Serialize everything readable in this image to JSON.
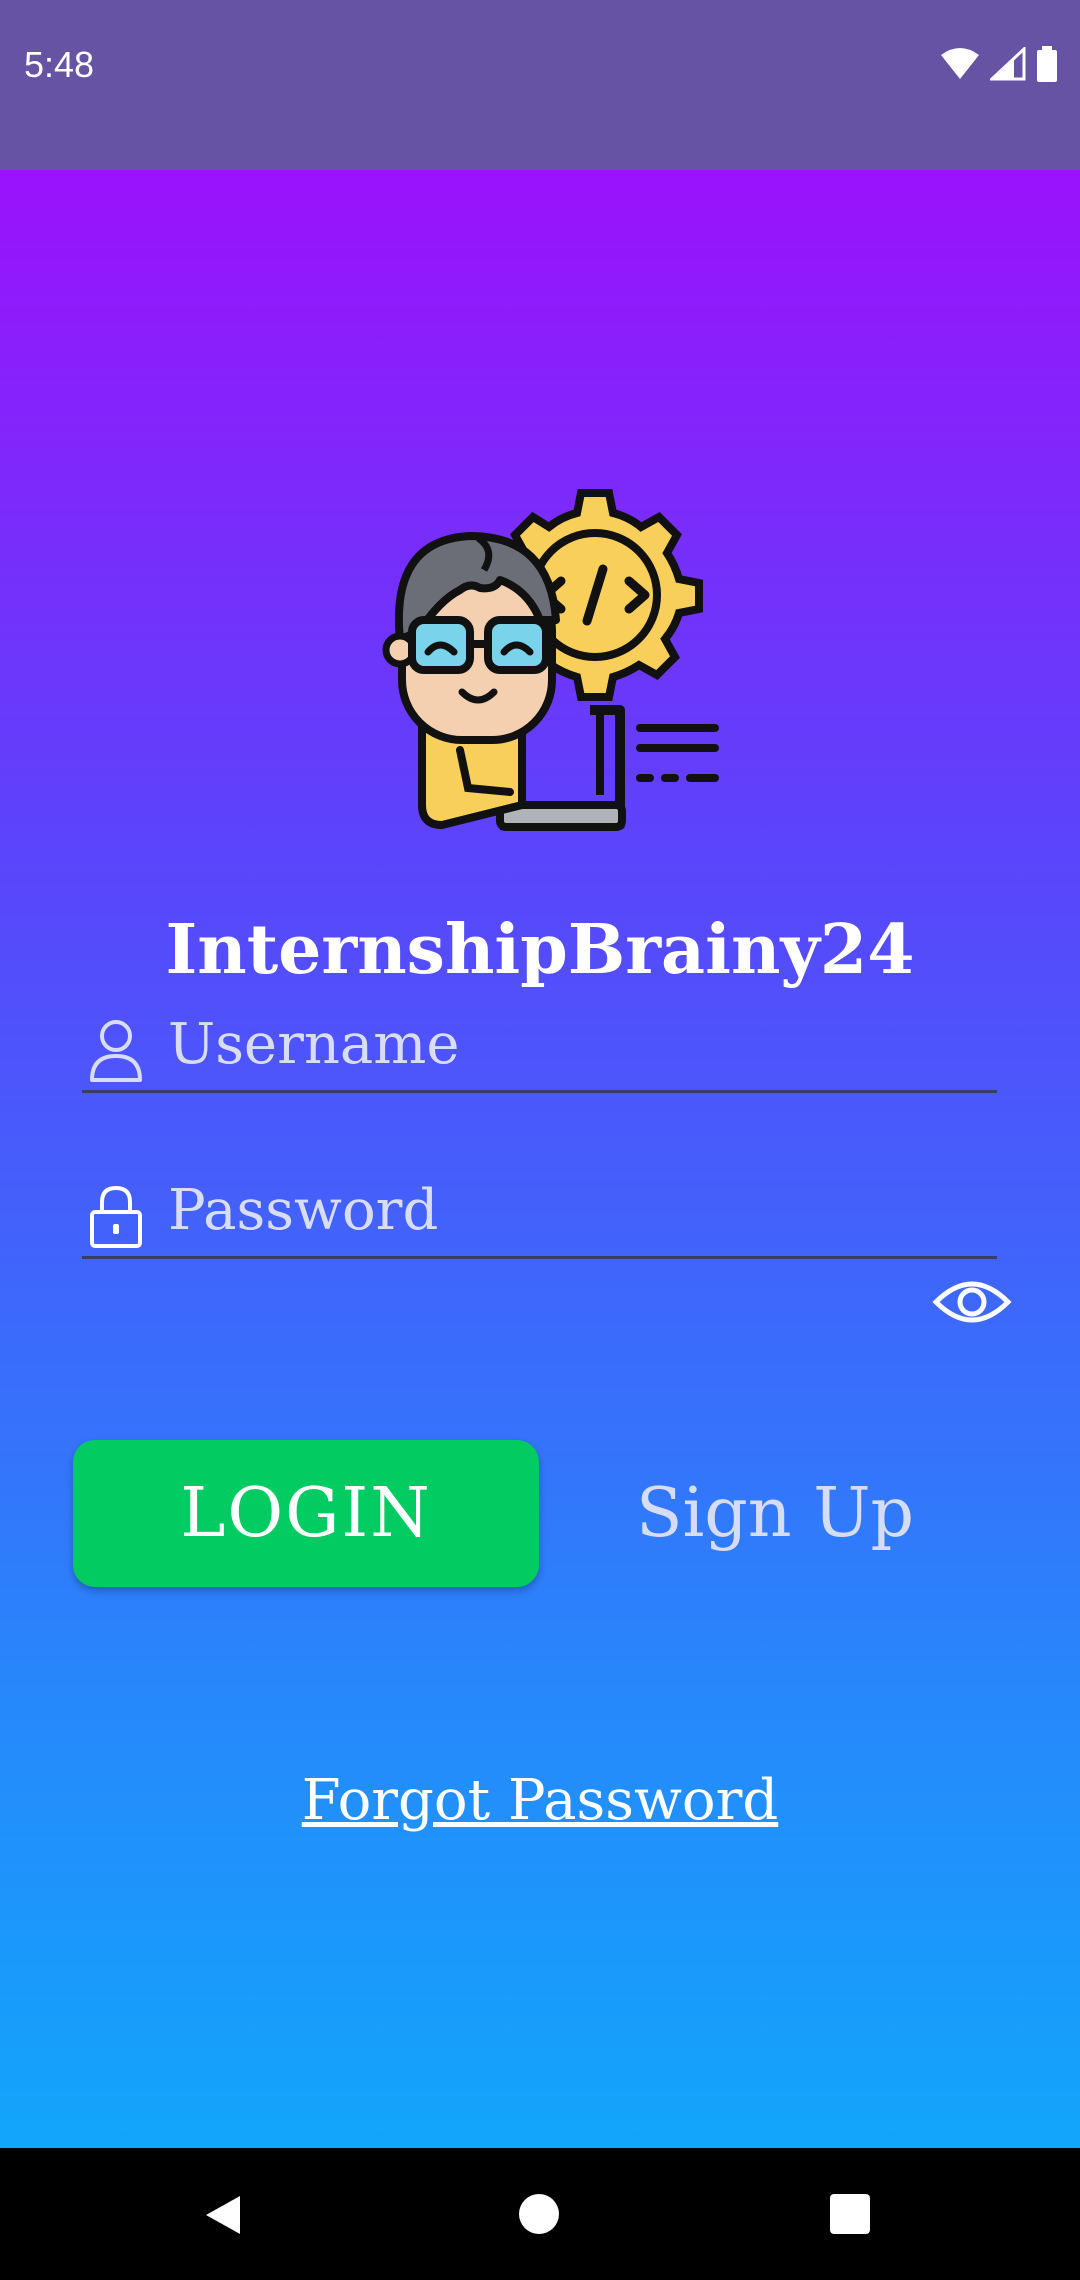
{
  "status_bar": {
    "time": "5:48",
    "icons": [
      "wifi-icon",
      "signal-icon",
      "battery-icon"
    ]
  },
  "app": {
    "title": "InternshipBrainy24",
    "logo": "developer-gear-laptop-illustration"
  },
  "form": {
    "username_placeholder": "Username",
    "password_placeholder": "Password",
    "username_icon": "user-icon",
    "password_icon": "lock-icon",
    "password_toggle_icon": "eye-icon"
  },
  "actions": {
    "login_label": "LOGIN",
    "signup_label": "Sign Up",
    "forgot_label": "Forgot Password"
  },
  "nav_bar": {
    "icons": [
      "back-icon",
      "home-icon",
      "recents-icon"
    ]
  },
  "colors": {
    "status_bar": "#6753a3",
    "gradient_top": "#9a12fb",
    "gradient_bottom": "#12a5fb",
    "login_button": "#02cb62",
    "text": "#ffffff"
  }
}
